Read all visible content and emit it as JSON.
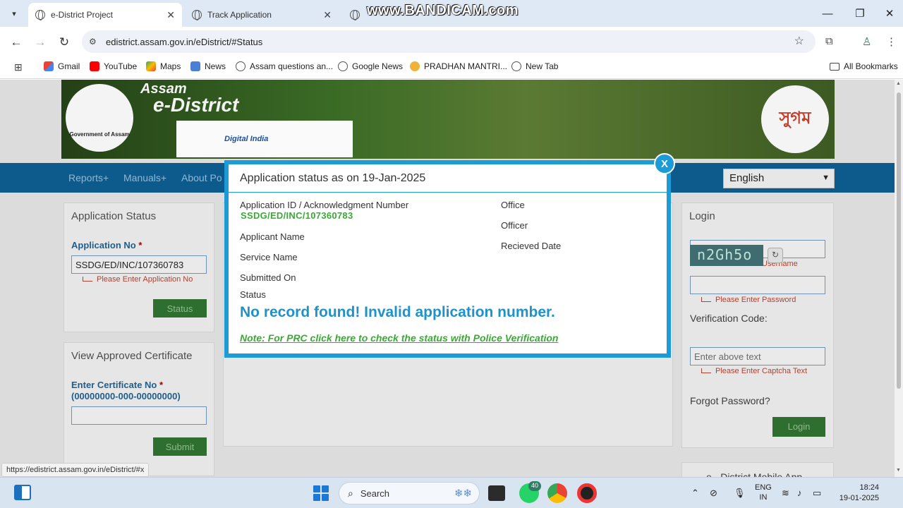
{
  "browser": {
    "tabs": [
      {
        "title": "e-District Project",
        "active": true
      },
      {
        "title": "Track Application",
        "active": false
      },
      {
        "title": "T",
        "active": false
      }
    ],
    "watermark": "www.BANDICAM.com",
    "url": "edistrict.assam.gov.in/eDistrict/#Status",
    "bookmarks": [
      "Gmail",
      "YouTube",
      "Maps",
      "News",
      "Assam questions an...",
      "Google News",
      "PRADHAN MANTRI...",
      "New Tab"
    ],
    "all_bookmarks": "All Bookmarks",
    "status_url": "https://edistrict.assam.gov.in/eDistrict/#x"
  },
  "banner": {
    "brand_line1": "Assam",
    "brand_line2": "e-District",
    "gov_label": "Government of Assam",
    "digital_india": "Digital India",
    "sugam": "সুগম"
  },
  "nav": {
    "items": [
      "Reports+",
      "Manuals+",
      "About Po"
    ],
    "language": "English"
  },
  "application_status_panel": {
    "title": "Application Status",
    "app_no_label": "Application No",
    "app_no_value": "SSDG/ED/INC/107360783",
    "app_no_error": "Please Enter Application No",
    "status_button": "Status"
  },
  "certificate_panel": {
    "title": "View Approved Certificate",
    "cert_label": "Enter Certificate No",
    "cert_format": "(00000000-000-00000000)",
    "submit_button": "Submit"
  },
  "login_panel": {
    "title": "Login",
    "username_error": "Please Enter Username",
    "password_error": "Please Enter Password",
    "verification_label": "Verification Code:",
    "captcha": "n2Gh5o",
    "captcha_placeholder": "Enter above text",
    "captcha_error": "Please Enter Captcha Text",
    "forgot": "Forgot Password?",
    "login_button": "Login",
    "mobile_app": "e - District Mobile App"
  },
  "modal": {
    "title": "Application status as on 19-Jan-2025",
    "close": "X",
    "app_id_label": "Application ID / Acknowledgment Number",
    "app_id_value": "SSDG/ED/INC/107360783",
    "applicant_name_label": "Applicant Name",
    "service_name_label": "Service Name",
    "submitted_on_label": "Submitted On",
    "status_label": "Status",
    "office_label": "Office",
    "officer_label": "Officer",
    "received_date_label": "Recieved Date",
    "result": "No record found! Invalid application number.",
    "note": "Note: For PRC click here to check the status with Police Verification"
  },
  "taskbar": {
    "search": "Search",
    "whatsapp_badge": "40",
    "lang_line1": "ENG",
    "lang_line2": "IN",
    "time": "18:24",
    "date": "19-01-2025"
  }
}
